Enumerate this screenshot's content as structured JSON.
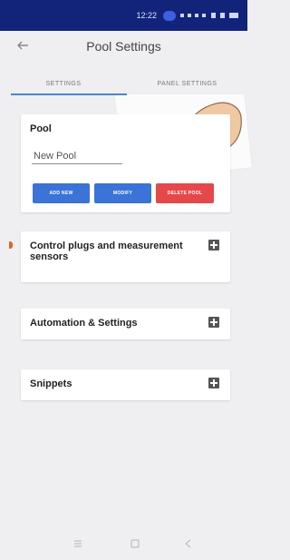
{
  "status_bar": {
    "time": "12:22"
  },
  "app_bar": {
    "title": "Pool Settings",
    "back_icon": "arrow-left-icon"
  },
  "tabs": [
    {
      "label": "SETTINGS",
      "active": true
    },
    {
      "label": "PANEL SETTINGS",
      "active": false
    }
  ],
  "pool_card": {
    "heading": "Pool",
    "name_value": "New Pool",
    "buttons": [
      {
        "label": "ADD NEW"
      },
      {
        "label": "MODIFY"
      },
      {
        "label": "DELETE POOL"
      }
    ]
  },
  "sections": [
    {
      "title": "Control plugs and measurement sensors",
      "icon": "plus-icon"
    },
    {
      "title": "Automation & Settings",
      "icon": "plus-icon"
    },
    {
      "title": "Snippets",
      "icon": "plus-icon"
    }
  ],
  "colors": {
    "status_bar": "#12237a",
    "primary_button": "#3b73d6",
    "danger_button": "#e5484b",
    "tab_indicator": "#4d83d6"
  },
  "nav_bar": {
    "icons": [
      "menu-icon",
      "home-icon",
      "back-icon"
    ]
  }
}
